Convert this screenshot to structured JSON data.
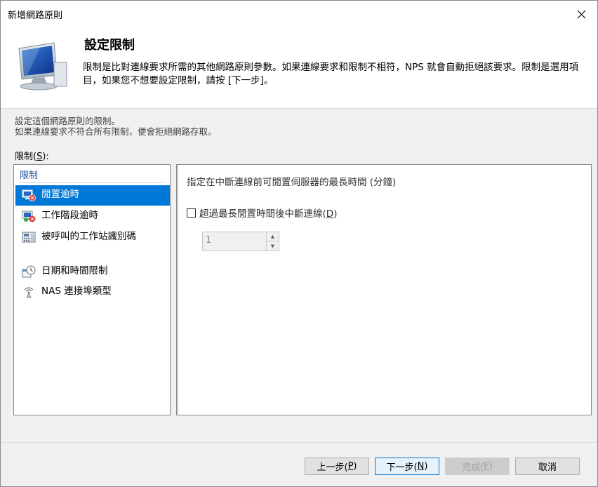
{
  "window": {
    "title": "新增網路原則"
  },
  "header": {
    "title": "設定限制",
    "description": "限制是比對連線要求所需的其他網路原則參數。如果連線要求和限制不相符，NPS 就會自動拒絕該要求。限制是選用項目，如果您不想要設定限制，請按 [下一步]。"
  },
  "intro": {
    "line1": "設定這個網路原則的限制。",
    "line2": "如果連線要求不符合所有限制，便會拒絕網路存取。"
  },
  "restrictions": {
    "label_text": "限制(",
    "label_mnemonic": "S",
    "label_end": "):",
    "group": "限制",
    "items": [
      {
        "label": "閒置逾時",
        "icon": "idle-timeout-icon"
      },
      {
        "label": "工作階段逾時",
        "icon": "session-timeout-icon"
      },
      {
        "label": "被呼叫的工作站識別碼",
        "icon": "called-station-id-icon"
      },
      {
        "label": "日期和時間限制",
        "icon": "day-time-icon"
      },
      {
        "label": "NAS 連接埠類型",
        "icon": "nas-port-type-icon"
      }
    ]
  },
  "detail": {
    "title": "指定在中斷連線前可閒置伺服器的最長時間 (分鐘)",
    "checkbox_text": "超過最長閒置時間後中斷連線(",
    "checkbox_mnemonic": "D",
    "checkbox_end": ")",
    "spinner_value": "1"
  },
  "footer": {
    "back_text": "上一步(",
    "back_key": "P",
    "next_text": "下一步(",
    "next_key": "N",
    "finish_text": "完成(",
    "finish_key": "F",
    "cancel": "取消",
    "close_paren": ")"
  },
  "colors": {
    "selection": "#0078d7",
    "group_header": "#1e4e9a"
  }
}
